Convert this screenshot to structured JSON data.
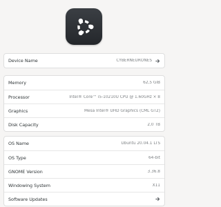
{
  "logo": {
    "icon": "ubuntu-circle-of-friends-icon",
    "bg_color": "#2b2e32",
    "fg_color": "#ffffff"
  },
  "device": {
    "name_label": "Device Name",
    "name_value": "CYBERNEURONES"
  },
  "hardware": {
    "rows": [
      {
        "label": "Memory",
        "value": "62,5 GiB"
      },
      {
        "label": "Processor",
        "value": "Intel® Core™ i5-10210U CPU @ 1.60GHz × 8"
      },
      {
        "label": "Graphics",
        "value": "Mesa Intel® UHD Graphics (CML GT2)"
      },
      {
        "label": "Disk Capacity",
        "value": "2,0 TB"
      }
    ]
  },
  "software": {
    "rows": [
      {
        "label": "OS Name",
        "value": "Ubuntu 20.04.1 LTS"
      },
      {
        "label": "OS Type",
        "value": "64-bit"
      },
      {
        "label": "GNOME Version",
        "value": "3.36.8"
      },
      {
        "label": "Windowing System",
        "value": "X11"
      }
    ],
    "updates_label": "Software Updates"
  }
}
